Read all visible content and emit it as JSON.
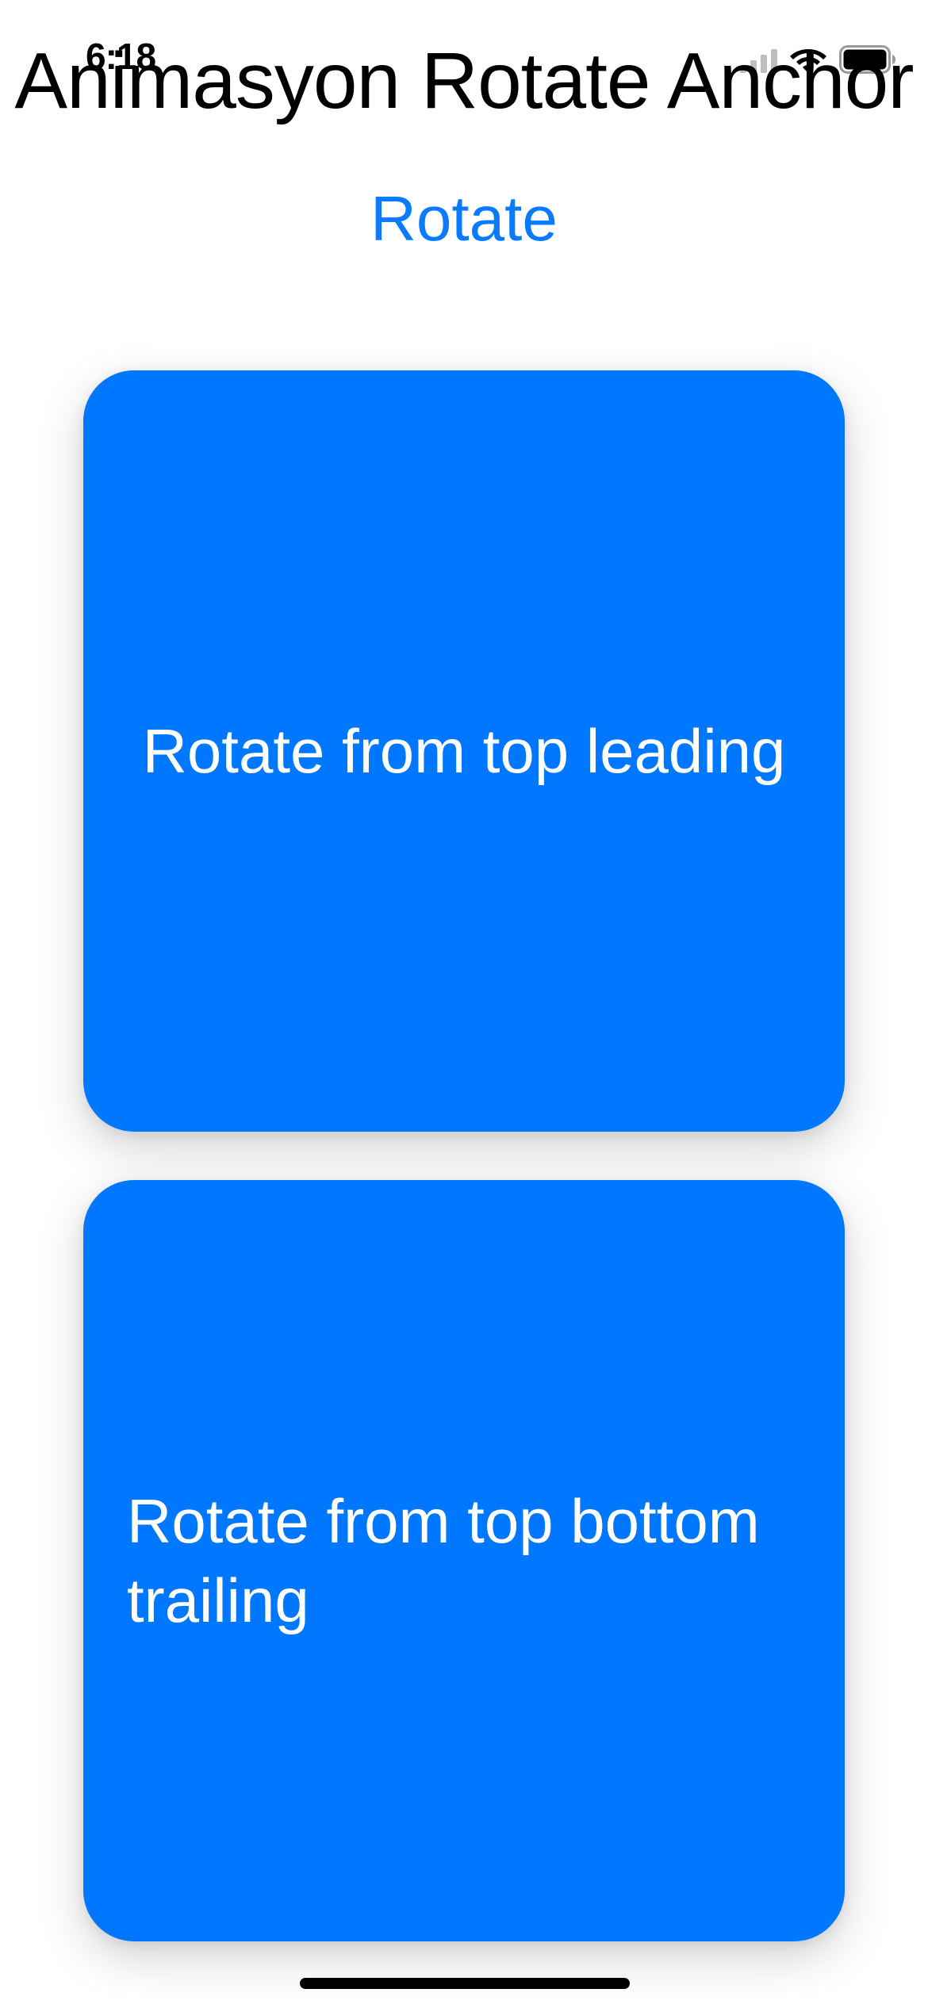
{
  "status_bar": {
    "time": "6:18"
  },
  "header": {
    "title": "Animasyon Rotate Anchor"
  },
  "actions": {
    "rotate_label": "Rotate"
  },
  "cards": [
    {
      "label": "Rotate from top leading"
    },
    {
      "label": "Rotate from top bottom trailing"
    }
  ],
  "colors": {
    "accent": "#0a7aff",
    "card_background": "#0077ff",
    "card_text": "#ffffff",
    "background": "#ffffff"
  },
  "icons": [
    "cellular-signal-icon",
    "wifi-icon",
    "battery-icon"
  ]
}
